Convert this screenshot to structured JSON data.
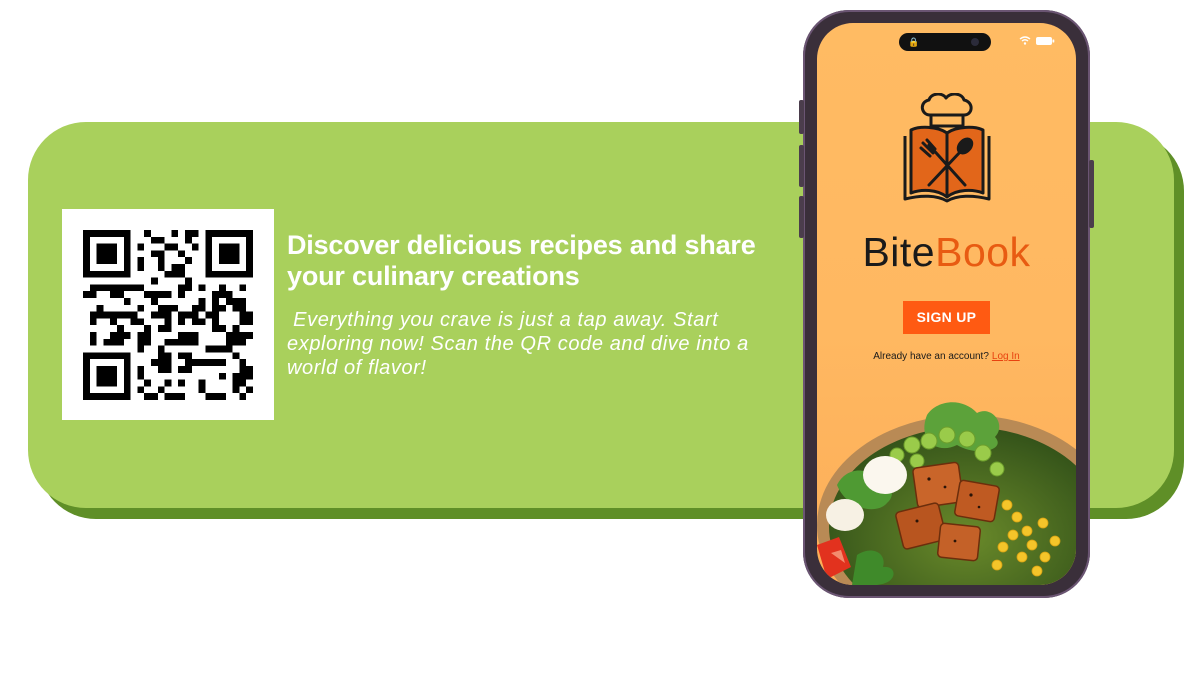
{
  "promo": {
    "headline": "Discover delicious recipes and share your culinary creations",
    "subtext": " Everything you crave is just a tap away. Start exploring now! Scan the QR code and dive into a world of flavor!"
  },
  "qr": {
    "icon": "qr-code"
  },
  "app": {
    "name_part1": "Bite",
    "name_part2": "Book",
    "signup_label": "SIGN UP",
    "login_prompt": "Already have an account?",
    "login_link": "Log In",
    "logo_icon": "chef-hat-book-fork-spoon",
    "hero_image": "salad-bowl"
  },
  "colors": {
    "banner_green": "#a9d05c",
    "banner_shadow": "#5f8f27",
    "app_orange": "#ff5a12",
    "screen_bg": "#ffbb63"
  }
}
